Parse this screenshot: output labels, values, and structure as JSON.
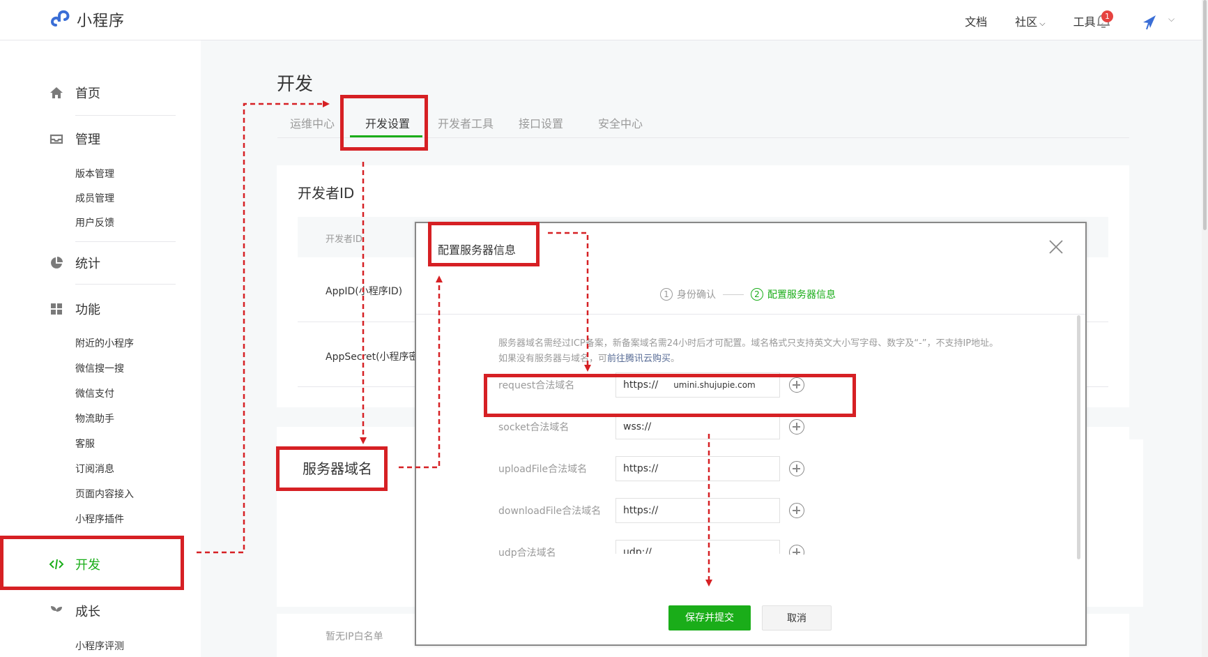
{
  "app": {
    "title": "小程序"
  },
  "topnav": {
    "docs": "文档",
    "community": "社区",
    "tools": "工具",
    "notif_count": "1"
  },
  "sidebar": {
    "home": "首页",
    "manage": "管理",
    "manage_items": [
      "版本管理",
      "成员管理",
      "用户反馈"
    ],
    "stats": "统计",
    "features": "功能",
    "feature_items": [
      "附近的小程序",
      "微信搜一搜",
      "微信支付",
      "物流助手",
      "客服",
      "订阅消息",
      "页面内容接入",
      "小程序插件"
    ],
    "develop": "开发",
    "growth": "成长",
    "growth_items": [
      "小程序评测"
    ]
  },
  "main": {
    "title": "开发",
    "tabs": [
      "运维中心",
      "开发设置",
      "开发者工具",
      "接口设置",
      "安全中心"
    ],
    "active_tab": 1,
    "developer_id_title": "开发者ID",
    "dev_id_header": "开发者ID",
    "appid_label": "AppID(小程序ID)",
    "appsecret_label": "AppSecret(小程序密",
    "server_domain_title": "服务器域名",
    "ip_whitelist_empty": "暂无IP白名单"
  },
  "modal": {
    "title": "配置服务器信息",
    "steps": [
      {
        "num": "1",
        "label": "身份确认"
      },
      {
        "num": "2",
        "label": "配置服务器信息"
      }
    ],
    "notice_part1": "服务器域名需经过ICP备案，新备案域名需24小时后才可配置。域名格式只支持英文大小写字母、数字及“-”，不支持IP地址。如果没有服务器与域名，可",
    "notice_link": "前往腾讯云购买",
    "notice_part2": "。",
    "fields": [
      {
        "label": "request合法域名",
        "prefix": "https://",
        "value": "umini.shujupie.com"
      },
      {
        "label": "socket合法域名",
        "prefix": "wss://",
        "value": ""
      },
      {
        "label": "uploadFile合法域名",
        "prefix": "https://",
        "value": ""
      },
      {
        "label": "downloadFile合法域名",
        "prefix": "https://",
        "value": ""
      },
      {
        "label": "udp合法域名",
        "prefix": "udp://",
        "value": ""
      }
    ],
    "save_label": "保存并提交",
    "cancel_label": "取消"
  },
  "colors": {
    "accent": "#1aad19",
    "annotation": "#d62024",
    "link": "#576b95"
  },
  "icons": [
    "logo-icon",
    "bell-icon",
    "avatar-icon",
    "home-icon",
    "inbox-icon",
    "pie-icon",
    "grid-icon",
    "code-icon",
    "sprout-icon",
    "close-icon",
    "plus-icon"
  ]
}
